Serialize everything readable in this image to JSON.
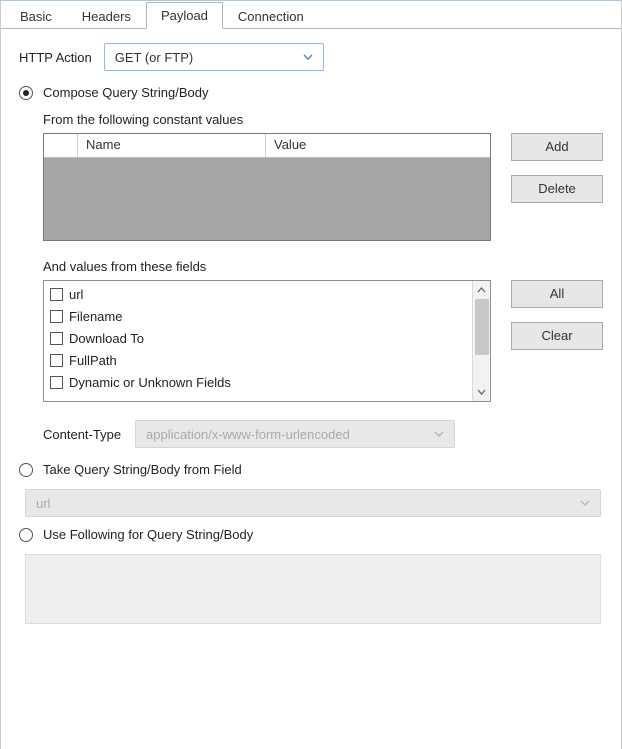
{
  "tabs": [
    "Basic",
    "Headers",
    "Payload",
    "Connection"
  ],
  "active_tab_index": 2,
  "http_action": {
    "label": "HTTP Action",
    "value": "GET (or FTP)"
  },
  "mode": {
    "compose": {
      "label": "Compose Query String/Body",
      "checked": true
    },
    "fromField": {
      "label": "Take Query String/Body from Field",
      "checked": false,
      "field_value": "url"
    },
    "literal": {
      "label": "Use Following for Query String/Body",
      "checked": false
    }
  },
  "constants": {
    "label": "From the following constant values",
    "columns": {
      "name": "Name",
      "value": "Value"
    },
    "rows": [],
    "buttons": {
      "add": "Add",
      "delete": "Delete"
    }
  },
  "fields": {
    "label": "And values from these fields",
    "items": [
      "url",
      "Filename",
      "Download To",
      "FullPath",
      "Dynamic or Unknown Fields"
    ],
    "buttons": {
      "all": "All",
      "clear": "Clear"
    }
  },
  "content_type": {
    "label": "Content-Type",
    "value": "application/x-www-form-urlencoded",
    "enabled": false
  },
  "colors": {
    "dropdown_border": "#8fb8e0",
    "grid_body": "#a6a6a6",
    "button_bg": "#e7e7e7"
  }
}
